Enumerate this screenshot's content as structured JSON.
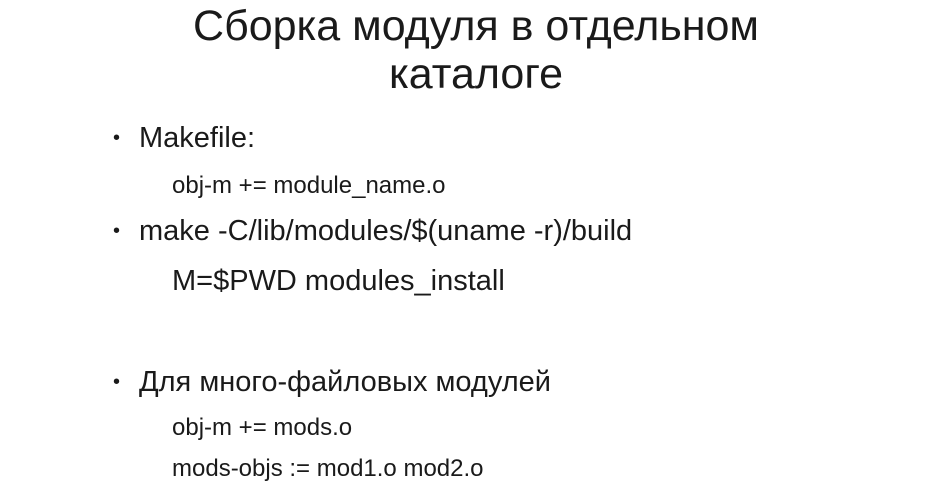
{
  "slide": {
    "title_line1": "Сборка модуля в отдельном",
    "title_line2": "каталоге",
    "items": [
      {
        "bullet": "•",
        "text": "Makefile:",
        "sub": [
          "obj-m += module_name.o"
        ]
      },
      {
        "bullet": "•",
        "text": "make -C/lib/modules/$(uname -r)/build",
        "continuation": "M=$PWD modules_install"
      },
      {
        "bullet": "•",
        "text": "Для много-файловых модулей",
        "sub": [
          "obj-m += mods.o",
          "mods-objs := mod1.o mod2.o"
        ]
      }
    ]
  }
}
